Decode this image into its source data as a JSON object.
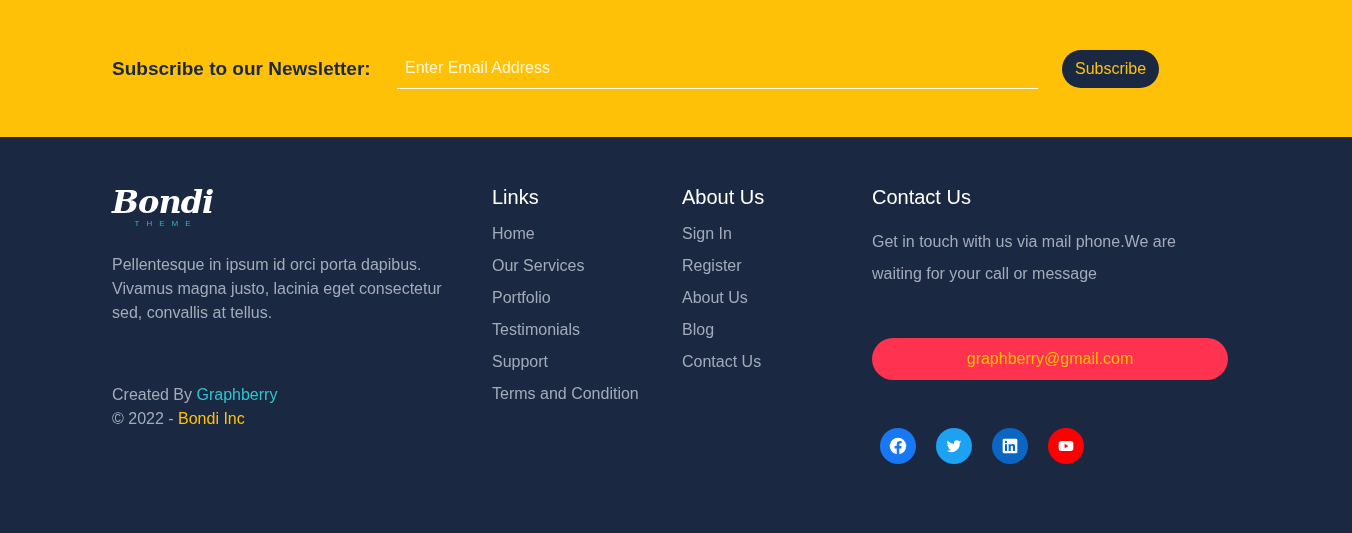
{
  "newsletter": {
    "label": "Subscribe to our Newsletter:",
    "placeholder": "Enter Email Address",
    "button": "Subscribe"
  },
  "brand": {
    "logo": "Bondi",
    "tagline": "THEME",
    "description": "Pellentesque in ipsum id orci porta dapibus. Vivamus magna justo, lacinia eget consectetur sed, convallis at tellus.",
    "created_by": "Created By",
    "creator": "Graphberry",
    "copyright": "© 2022 -",
    "company": "Bondi Inc"
  },
  "link_columns": [
    {
      "title": "Links",
      "items": [
        "Home",
        "Our Services",
        "Portfolio",
        "Testimonials",
        "Support",
        "Terms and Condition"
      ]
    },
    {
      "title": "About Us",
      "items": [
        "Sign In",
        "Register",
        "About Us",
        "Blog",
        "Contact Us"
      ]
    }
  ],
  "contact": {
    "title": "Contact Us",
    "text": "Get in touch with us via mail phone.We are waiting for your call or message",
    "email": "graphberry@gmail.com"
  },
  "social": [
    {
      "kind": "facebook",
      "color": "#1877f2"
    },
    {
      "kind": "twitter",
      "color": "#1da1f2"
    },
    {
      "kind": "linkedin",
      "color": "#0a66c2"
    },
    {
      "kind": "youtube",
      "color": "#ff0000"
    }
  ]
}
